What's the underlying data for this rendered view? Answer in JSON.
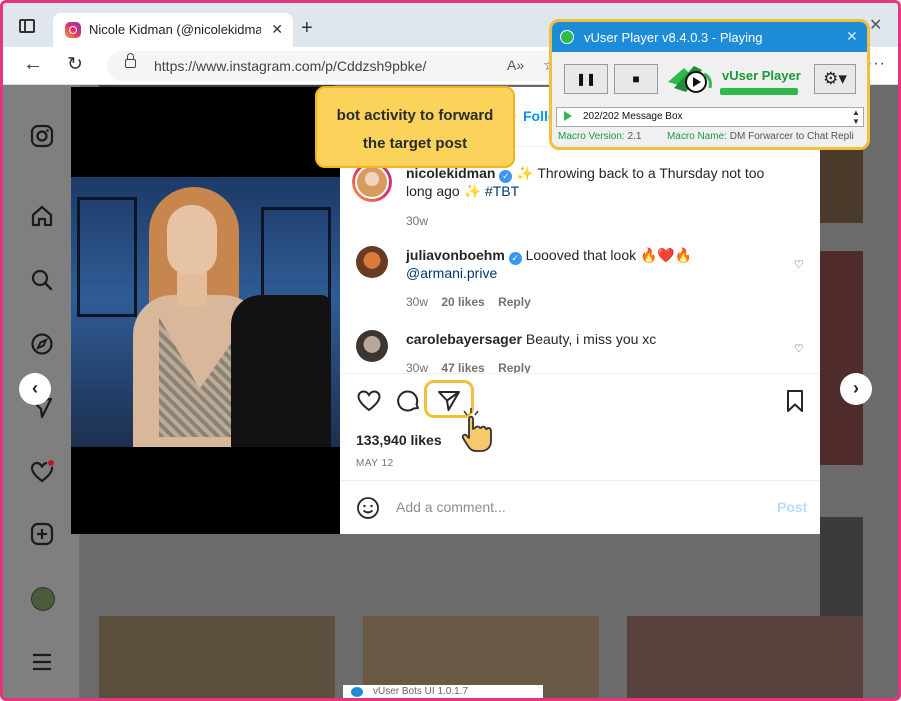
{
  "browser": {
    "tab_title": "Nicole Kidman (@nicolekidman)",
    "tab_close": "✕",
    "new_tab": "+",
    "window_close": "✕",
    "url": "https://www.instagram.com/p/Cddzsh9pbke/",
    "read_aloud": "A»",
    "favorite": "☆",
    "more": "···"
  },
  "callout": {
    "line1": "bot activity to forward",
    "line2": "the target post"
  },
  "post": {
    "author": "nicolekidman",
    "separator": "•",
    "follow_label": "Follow",
    "more": "···",
    "caption_user": "nicolekidman",
    "caption_text_1": "✨ Throwing back to a Thursday not too",
    "caption_text_2": "long ago ✨ ",
    "caption_hashtag": "#TBT",
    "caption_age": "30w",
    "comments": [
      {
        "user": "juliavonboehm",
        "text": "Loooved that look 🔥❤️🔥",
        "mention": "@armani.prive",
        "age": "30w",
        "likes": "20 likes",
        "reply": "Reply"
      },
      {
        "user": "carolebayersager",
        "text": "Beauty, i miss you xc",
        "age": "30w",
        "likes": "47 likes",
        "reply": "Reply"
      }
    ],
    "like_count": "133,940 likes",
    "date": "MAY 12",
    "comment_placeholder": "Add a comment...",
    "post_label": "Post"
  },
  "carousel": {
    "prev": "‹",
    "next": "›"
  },
  "player": {
    "title": "vUser Player v8.4.0.3 - Playing",
    "close": "✕",
    "pause_icon": "❚❚",
    "stop_icon": "■",
    "brand": "vUser Player",
    "settings_icon": "⚙▾",
    "status": "202/202 Message Box",
    "spin_up": "▲",
    "spin_down": "▼",
    "macro_version_label": "Macro Version:",
    "macro_version": "2.1",
    "macro_name_label": "Macro Name:",
    "macro_name": "DM Forwarcer to Chat Repli"
  },
  "footer": {
    "text": "vUser Bots UI 1.0.1.7"
  },
  "colors": {
    "accent_pink": "#e2377e",
    "callout_yellow": "#fbd35a",
    "instagram_blue": "#0095f6",
    "player_title_blue": "#1c8cd9",
    "player_green": "#2fb94a"
  }
}
